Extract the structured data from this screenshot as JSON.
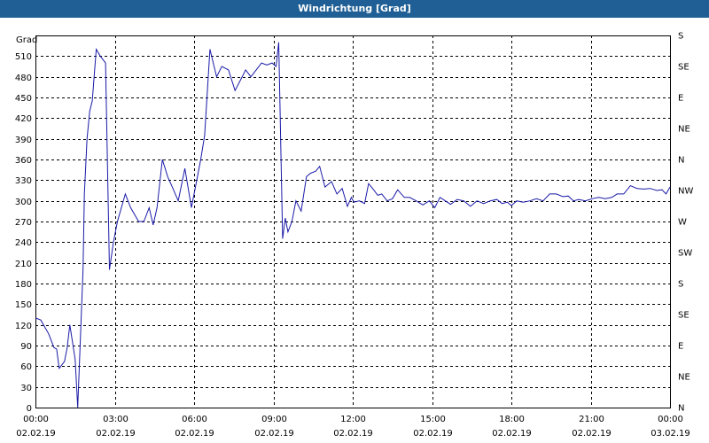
{
  "window": {
    "title": "Windrichtung [Grad]"
  },
  "chart_data": {
    "type": "line",
    "title": "Windrichtung [Grad]",
    "ylabel": "Grad",
    "ylim": [
      0,
      540
    ],
    "xlim_hours": [
      0,
      24
    ],
    "yticks": [
      0,
      30,
      60,
      90,
      120,
      150,
      180,
      210,
      240,
      270,
      300,
      330,
      360,
      390,
      420,
      450,
      480,
      510
    ],
    "right_axis_labels": [
      "N",
      "NE",
      "E",
      "SE",
      "S",
      "SW",
      "W",
      "NW",
      "N",
      "NE",
      "E",
      "SE",
      "S"
    ],
    "x_tick_labels": [
      {
        "time": "00:00",
        "date": "02.02.19"
      },
      {
        "time": "03:00",
        "date": "02.02.19"
      },
      {
        "time": "06:00",
        "date": "02.02.19"
      },
      {
        "time": "09:00",
        "date": "02.02.19"
      },
      {
        "time": "12:00",
        "date": "02.02.19"
      },
      {
        "time": "15:00",
        "date": "02.02.19"
      },
      {
        "time": "18:00",
        "date": "02.02.19"
      },
      {
        "time": "21:00",
        "date": "02.02.19"
      },
      {
        "time": "00:00",
        "date": "03.02.19"
      }
    ],
    "grid": true,
    "line_color": "#1a1aa8",
    "series": [
      {
        "x": [
          0.0,
          0.2,
          0.5,
          0.7,
          0.8,
          0.9,
          1.1,
          1.2,
          1.3,
          1.5,
          1.6,
          1.8,
          1.85,
          1.95,
          2.05,
          2.15,
          2.3,
          2.45,
          2.65,
          2.8,
          2.95,
          3.1,
          3.4,
          3.6,
          3.9,
          4.1,
          4.3,
          4.45,
          4.6,
          4.8,
          5.0,
          5.2,
          5.4,
          5.65,
          5.9,
          6.05,
          6.25,
          6.4,
          6.6,
          6.85,
          7.05,
          7.3,
          7.55,
          7.75,
          7.95,
          8.15,
          8.35,
          8.55,
          8.75,
          8.95,
          9.1,
          9.2,
          9.35,
          9.45,
          9.55,
          9.7,
          9.85,
          10.05,
          10.25,
          10.4,
          10.6,
          10.75,
          10.95,
          11.2,
          11.4,
          11.6,
          11.8,
          11.95,
          12.05,
          12.25,
          12.45,
          12.6,
          12.75,
          12.95,
          13.1,
          13.3,
          13.5,
          13.7,
          13.95,
          14.15,
          14.4,
          14.65,
          14.9,
          15.1,
          15.3,
          15.5,
          15.7,
          15.95,
          16.2,
          16.45,
          16.7,
          16.95,
          17.2,
          17.45,
          17.65,
          17.85,
          18.0,
          18.2,
          18.45,
          18.7,
          18.95,
          19.2,
          19.45,
          19.7,
          19.95,
          20.15,
          20.35,
          20.55,
          20.8,
          21.05,
          21.3,
          21.55,
          21.8,
          22.0,
          22.25,
          22.5,
          22.75,
          23.0,
          23.25,
          23.5,
          23.7,
          23.85,
          24.0
        ],
        "y": [
          130,
          127,
          107,
          87,
          85,
          57,
          67,
          87,
          120,
          70,
          0,
          200,
          310,
          390,
          430,
          445,
          520,
          510,
          500,
          200,
          240,
          270,
          310,
          290,
          270,
          270,
          290,
          265,
          290,
          360,
          335,
          318,
          300,
          347,
          290,
          320,
          360,
          395,
          520,
          480,
          495,
          490,
          460,
          475,
          490,
          480,
          490,
          500,
          497,
          500,
          495,
          530,
          245,
          275,
          255,
          270,
          300,
          285,
          335,
          340,
          343,
          350,
          320,
          328,
          310,
          318,
          292,
          305,
          298,
          300,
          296,
          325,
          318,
          308,
          310,
          300,
          303,
          316,
          305,
          305,
          300,
          294,
          300,
          290,
          305,
          300,
          295,
          302,
          300,
          292,
          300,
          296,
          300,
          302,
          296,
          298,
          293,
          300,
          298,
          300,
          303,
          300,
          310,
          310,
          306,
          307,
          300,
          302,
          300,
          303,
          305,
          303,
          305,
          310,
          310,
          322,
          318,
          317,
          318,
          315,
          316,
          310,
          320
        ]
      }
    ]
  }
}
